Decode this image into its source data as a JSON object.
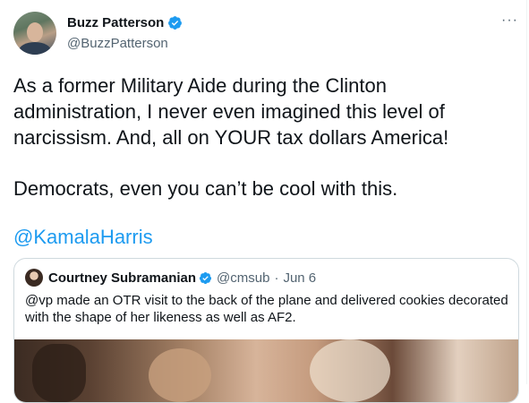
{
  "author": {
    "name": "Buzz Patterson",
    "handle": "@BuzzPatterson",
    "verified_icon": "verified-badge-icon"
  },
  "more_label": "···",
  "tweet": {
    "paragraph1": "As a former Military Aide during the Clinton administration, I never even imagined this level of narcissism. And, all on YOUR tax dollars America!",
    "paragraph2": "Democrats, even you can’t be cool with this.",
    "mention": "@KamalaHarris"
  },
  "quoted": {
    "name": "Courtney Subramanian",
    "handle": "@cmsub",
    "separator": "·",
    "date": "Jun 6",
    "text": "@vp made an OTR visit to the back of the plane and delivered cookies decorated with the shape of her likeness as well as AF2."
  },
  "colors": {
    "link": "#1d9bf0",
    "verified": "#1d9bf0",
    "muted": "#536471",
    "text": "#0f1419",
    "border": "#cfd9de"
  }
}
